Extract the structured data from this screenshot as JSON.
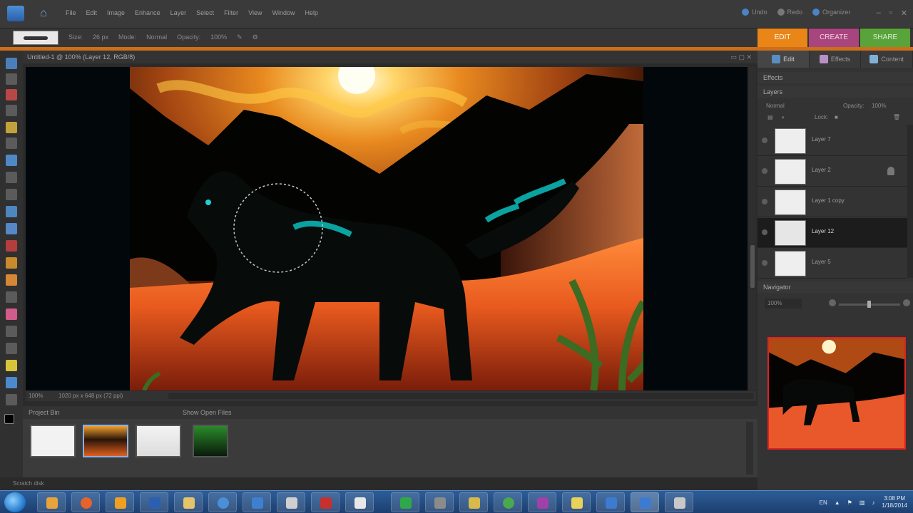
{
  "menubar": {
    "items": [
      "File",
      "Edit",
      "Image",
      "Enhance",
      "Layer",
      "Select",
      "Filter",
      "View",
      "Window",
      "Help"
    ],
    "right_items": [
      "Undo",
      "Redo",
      "Organizer"
    ]
  },
  "options_bar": {
    "size_label": "Size:",
    "size_value": "26 px",
    "mode_label": "Mode:",
    "mode_value": "Normal",
    "opacity_label": "Opacity:",
    "opacity_value": "100%"
  },
  "mode_tabs": {
    "edit": "EDIT",
    "create": "CREATE",
    "share": "SHARE"
  },
  "document": {
    "title": "Untitled-1 @ 100% (Layer 12, RGB/8)",
    "zoom": "100%",
    "info": "1020 px x 648 px (72 ppi)"
  },
  "project_bin": {
    "title": "Project Bin",
    "show_label": "Show Open Files",
    "thumb_count": 4
  },
  "bottom_status": "Scratch disk",
  "panel": {
    "tabs": [
      "Edit",
      "Effects",
      "Content"
    ],
    "effects_header": "Effects",
    "layers_header": "Layers",
    "blend_mode": "Normal",
    "opacity_label": "Opacity:",
    "opacity_value": "100%",
    "lock_label": "Lock:",
    "layers": [
      {
        "name": "Layer 7",
        "locked": false
      },
      {
        "name": "Layer 2",
        "locked": true
      },
      {
        "name": "Layer 1 copy",
        "locked": false
      },
      {
        "name": "Layer 12",
        "locked": false
      },
      {
        "name": "Layer 5",
        "locked": false
      }
    ],
    "selected_layer_index": 3,
    "navigator_header": "Navigator",
    "nav_zoom": "100%"
  },
  "taskbar": {
    "apps": [
      "Windows Explorer",
      "Firefox",
      "Media Player",
      "Microsoft Word",
      "Folder",
      "Internet Explorer",
      "Photoshop Elements",
      "Adobe Reader",
      "Notepad",
      "Excel",
      "Paint",
      "Picasa",
      "Chrome",
      "OneNote",
      "Messenger",
      "Elements Editor",
      "Elements Organizer",
      "Paint.NET"
    ],
    "tray_lang": "EN",
    "time": "3:08 PM",
    "date": "1/18/2014"
  },
  "colors": {
    "accent_edit": "#e98617",
    "accent_create": "#a8457f",
    "accent_share": "#58a33a",
    "selection_outline": "#dd2222"
  },
  "icons": [
    "home-icon",
    "brush-icon",
    "zoom-icon",
    "move-icon",
    "lasso-icon",
    "text-icon",
    "eye-icon",
    "lock-icon"
  ]
}
